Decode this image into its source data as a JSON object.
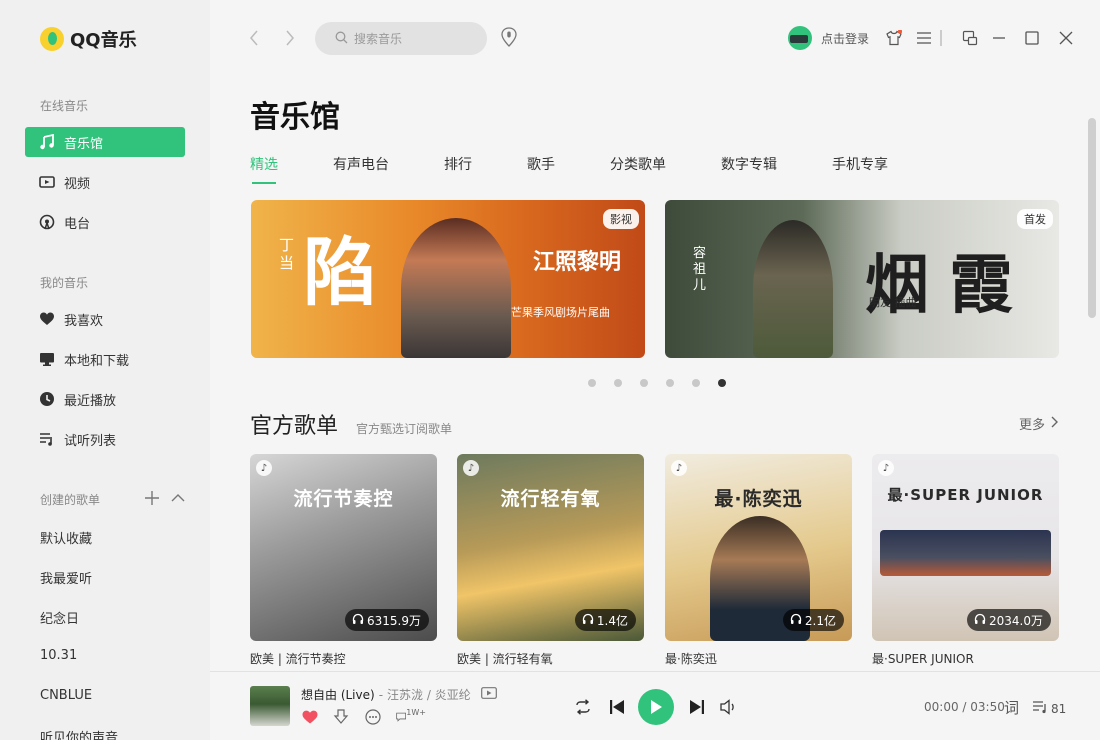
{
  "app": {
    "name": "QQ音乐"
  },
  "sidebar": {
    "online_title": "在线音乐",
    "online_items": [
      {
        "label": "音乐馆",
        "icon": "music-note-icon",
        "active": true
      },
      {
        "label": "视频",
        "icon": "video-icon"
      },
      {
        "label": "电台",
        "icon": "radio-icon"
      }
    ],
    "my_title": "我的音乐",
    "my_items": [
      {
        "label": "我喜欢",
        "icon": "heart-icon"
      },
      {
        "label": "本地和下载",
        "icon": "monitor-icon"
      },
      {
        "label": "最近播放",
        "icon": "clock-icon"
      },
      {
        "label": "试听列表",
        "icon": "playlist-icon"
      }
    ],
    "created_title": "创建的歌单",
    "playlists": [
      "默认收藏",
      "我最爱听",
      "纪念日",
      "10.31",
      "CNBLUE",
      "听见你的声音"
    ]
  },
  "topbar": {
    "search_placeholder": "搜索音乐",
    "login_label": "点击登录"
  },
  "main": {
    "title": "音乐馆",
    "tabs": [
      "精选",
      "有声电台",
      "排行",
      "歌手",
      "分类歌单",
      "数字专辑",
      "手机专享"
    ],
    "active_tab": "精选",
    "banners": [
      {
        "tag": "影视",
        "big_text": "陷",
        "artist": "丁当",
        "title_art": "江照黎明",
        "subtitle": "芒果季风剧场片尾曲"
      },
      {
        "tag": "首发",
        "big_text": "烟霞",
        "artist": "容祖儿",
        "subtitle": "明友 插曲"
      }
    ],
    "carousel_total": 6,
    "carousel_active": 6,
    "section": {
      "title": "官方歌单",
      "subtitle": "官方甄选订阅歌单",
      "more_label": "更多"
    },
    "playlists": [
      {
        "cover_title": "流行节奏控",
        "plays": "6315.9万",
        "name": "欧美 | 流行节奏控"
      },
      {
        "cover_title": "流行轻有氧",
        "plays": "1.4亿",
        "name": "欧美 | 流行轻有氧"
      },
      {
        "cover_title": "最·陈奕迅",
        "plays": "2.1亿",
        "name": "最·陈奕迅"
      },
      {
        "cover_title": "最·SUPER JUNIOR",
        "plays": "2034.0万",
        "name": "最·SUPER JUNIOR"
      }
    ]
  },
  "player": {
    "song_title": "想自由 (Live)",
    "separator": "-",
    "artists": "汪苏泷 / 炎亚纶",
    "comment_badge": "1W+",
    "time": "00:00 / 03:50",
    "lyrics_label": "词",
    "queue_count": "81",
    "accent": "#31c27c",
    "like_color": "#f25161"
  }
}
